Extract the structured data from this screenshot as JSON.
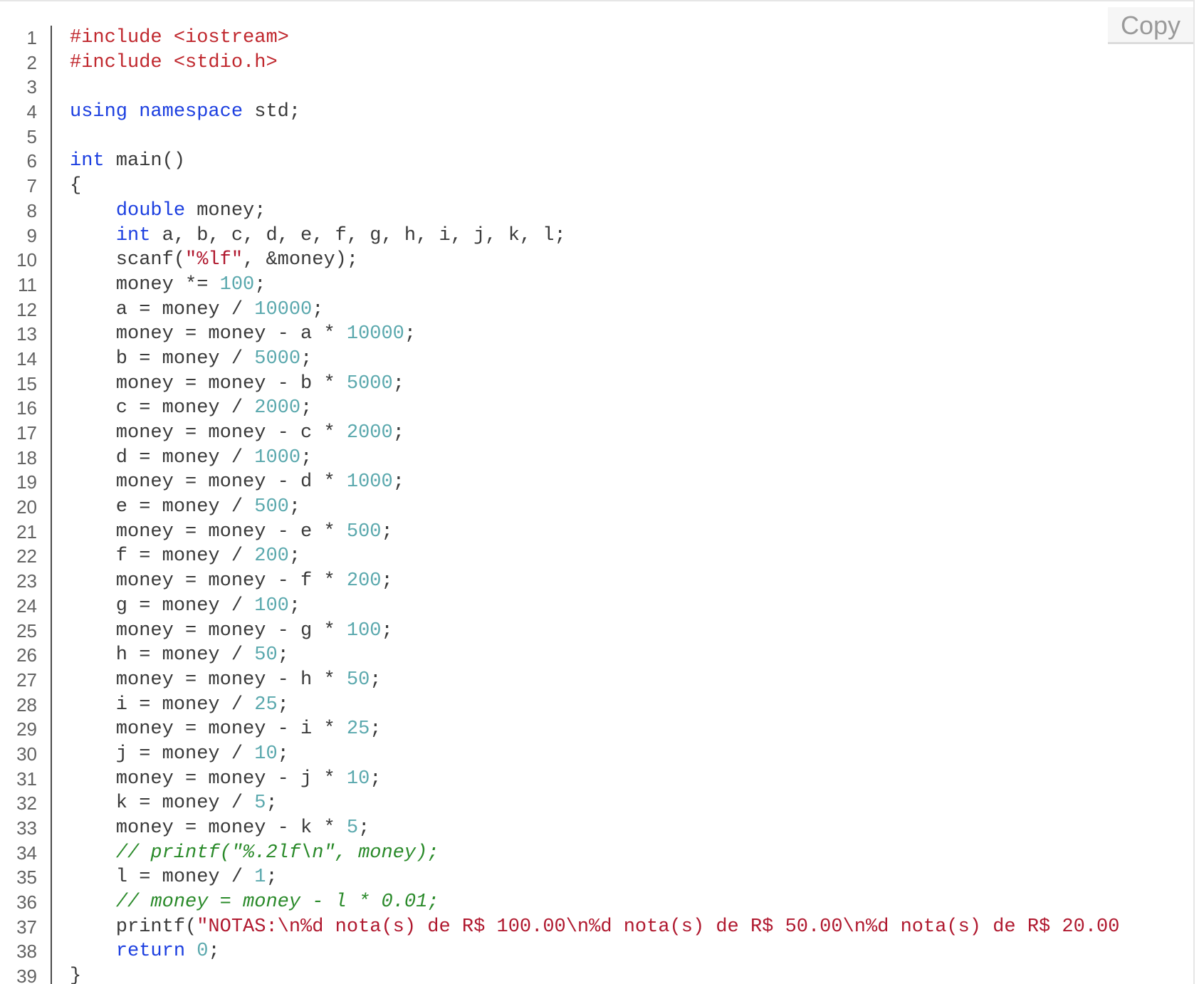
{
  "copy_button": {
    "label": "Copy"
  },
  "colors": {
    "keyword": "#1c3fe0",
    "preprocessor": "#c0282e",
    "string": "#b0192f",
    "number": "#5aa8ad",
    "comment": "#2a8a2a",
    "plain": "#3a3a3a",
    "line_number": "#636363"
  },
  "code": {
    "language": "cpp",
    "lines": [
      {
        "n": "1",
        "tokens": [
          {
            "t": "preproc",
            "v": "#include <iostream>"
          }
        ]
      },
      {
        "n": "2",
        "tokens": [
          {
            "t": "preproc",
            "v": "#include <stdio.h>"
          }
        ]
      },
      {
        "n": "3",
        "tokens": []
      },
      {
        "n": "4",
        "tokens": [
          {
            "t": "keyword",
            "v": "using"
          },
          {
            "t": "plain",
            "v": " "
          },
          {
            "t": "keyword",
            "v": "namespace"
          },
          {
            "t": "plain",
            "v": " std;"
          }
        ]
      },
      {
        "n": "5",
        "tokens": []
      },
      {
        "n": "6",
        "tokens": [
          {
            "t": "keyword",
            "v": "int"
          },
          {
            "t": "plain",
            "v": " main()"
          }
        ]
      },
      {
        "n": "7",
        "tokens": [
          {
            "t": "plain",
            "v": "{"
          }
        ]
      },
      {
        "n": "8",
        "tokens": [
          {
            "t": "plain",
            "v": "    "
          },
          {
            "t": "keyword",
            "v": "double"
          },
          {
            "t": "plain",
            "v": " money;"
          }
        ]
      },
      {
        "n": "9",
        "tokens": [
          {
            "t": "plain",
            "v": "    "
          },
          {
            "t": "keyword",
            "v": "int"
          },
          {
            "t": "plain",
            "v": " a, b, c, d, e, f, g, h, i, j, k, l;"
          }
        ]
      },
      {
        "n": "10",
        "tokens": [
          {
            "t": "plain",
            "v": "    scanf("
          },
          {
            "t": "string",
            "v": "\"%lf\""
          },
          {
            "t": "plain",
            "v": ", &money);"
          }
        ]
      },
      {
        "n": "11",
        "tokens": [
          {
            "t": "plain",
            "v": "    money *= "
          },
          {
            "t": "number",
            "v": "100"
          },
          {
            "t": "plain",
            "v": ";"
          }
        ]
      },
      {
        "n": "12",
        "tokens": [
          {
            "t": "plain",
            "v": "    a = money / "
          },
          {
            "t": "number",
            "v": "10000"
          },
          {
            "t": "plain",
            "v": ";"
          }
        ]
      },
      {
        "n": "13",
        "tokens": [
          {
            "t": "plain",
            "v": "    money = money - a * "
          },
          {
            "t": "number",
            "v": "10000"
          },
          {
            "t": "plain",
            "v": ";"
          }
        ]
      },
      {
        "n": "14",
        "tokens": [
          {
            "t": "plain",
            "v": "    b = money / "
          },
          {
            "t": "number",
            "v": "5000"
          },
          {
            "t": "plain",
            "v": ";"
          }
        ]
      },
      {
        "n": "15",
        "tokens": [
          {
            "t": "plain",
            "v": "    money = money - b * "
          },
          {
            "t": "number",
            "v": "5000"
          },
          {
            "t": "plain",
            "v": ";"
          }
        ]
      },
      {
        "n": "16",
        "tokens": [
          {
            "t": "plain",
            "v": "    c = money / "
          },
          {
            "t": "number",
            "v": "2000"
          },
          {
            "t": "plain",
            "v": ";"
          }
        ]
      },
      {
        "n": "17",
        "tokens": [
          {
            "t": "plain",
            "v": "    money = money - c * "
          },
          {
            "t": "number",
            "v": "2000"
          },
          {
            "t": "plain",
            "v": ";"
          }
        ]
      },
      {
        "n": "18",
        "tokens": [
          {
            "t": "plain",
            "v": "    d = money / "
          },
          {
            "t": "number",
            "v": "1000"
          },
          {
            "t": "plain",
            "v": ";"
          }
        ]
      },
      {
        "n": "19",
        "tokens": [
          {
            "t": "plain",
            "v": "    money = money - d * "
          },
          {
            "t": "number",
            "v": "1000"
          },
          {
            "t": "plain",
            "v": ";"
          }
        ]
      },
      {
        "n": "20",
        "tokens": [
          {
            "t": "plain",
            "v": "    e = money / "
          },
          {
            "t": "number",
            "v": "500"
          },
          {
            "t": "plain",
            "v": ";"
          }
        ]
      },
      {
        "n": "21",
        "tokens": [
          {
            "t": "plain",
            "v": "    money = money - e * "
          },
          {
            "t": "number",
            "v": "500"
          },
          {
            "t": "plain",
            "v": ";"
          }
        ]
      },
      {
        "n": "22",
        "tokens": [
          {
            "t": "plain",
            "v": "    f = money / "
          },
          {
            "t": "number",
            "v": "200"
          },
          {
            "t": "plain",
            "v": ";"
          }
        ]
      },
      {
        "n": "23",
        "tokens": [
          {
            "t": "plain",
            "v": "    money = money - f * "
          },
          {
            "t": "number",
            "v": "200"
          },
          {
            "t": "plain",
            "v": ";"
          }
        ]
      },
      {
        "n": "24",
        "tokens": [
          {
            "t": "plain",
            "v": "    g = money / "
          },
          {
            "t": "number",
            "v": "100"
          },
          {
            "t": "plain",
            "v": ";"
          }
        ]
      },
      {
        "n": "25",
        "tokens": [
          {
            "t": "plain",
            "v": "    money = money - g * "
          },
          {
            "t": "number",
            "v": "100"
          },
          {
            "t": "plain",
            "v": ";"
          }
        ]
      },
      {
        "n": "26",
        "tokens": [
          {
            "t": "plain",
            "v": "    h = money / "
          },
          {
            "t": "number",
            "v": "50"
          },
          {
            "t": "plain",
            "v": ";"
          }
        ]
      },
      {
        "n": "27",
        "tokens": [
          {
            "t": "plain",
            "v": "    money = money - h * "
          },
          {
            "t": "number",
            "v": "50"
          },
          {
            "t": "plain",
            "v": ";"
          }
        ]
      },
      {
        "n": "28",
        "tokens": [
          {
            "t": "plain",
            "v": "    i = money / "
          },
          {
            "t": "number",
            "v": "25"
          },
          {
            "t": "plain",
            "v": ";"
          }
        ]
      },
      {
        "n": "29",
        "tokens": [
          {
            "t": "plain",
            "v": "    money = money - i * "
          },
          {
            "t": "number",
            "v": "25"
          },
          {
            "t": "plain",
            "v": ";"
          }
        ]
      },
      {
        "n": "30",
        "tokens": [
          {
            "t": "plain",
            "v": "    j = money / "
          },
          {
            "t": "number",
            "v": "10"
          },
          {
            "t": "plain",
            "v": ";"
          }
        ]
      },
      {
        "n": "31",
        "tokens": [
          {
            "t": "plain",
            "v": "    money = money - j * "
          },
          {
            "t": "number",
            "v": "10"
          },
          {
            "t": "plain",
            "v": ";"
          }
        ]
      },
      {
        "n": "32",
        "tokens": [
          {
            "t": "plain",
            "v": "    k = money / "
          },
          {
            "t": "number",
            "v": "5"
          },
          {
            "t": "plain",
            "v": ";"
          }
        ]
      },
      {
        "n": "33",
        "tokens": [
          {
            "t": "plain",
            "v": "    money = money - k * "
          },
          {
            "t": "number",
            "v": "5"
          },
          {
            "t": "plain",
            "v": ";"
          }
        ]
      },
      {
        "n": "34",
        "tokens": [
          {
            "t": "plain",
            "v": "    "
          },
          {
            "t": "comment",
            "v": "// printf(\"%.2lf\\n\", money);"
          }
        ]
      },
      {
        "n": "35",
        "tokens": [
          {
            "t": "plain",
            "v": "    l = money / "
          },
          {
            "t": "number",
            "v": "1"
          },
          {
            "t": "plain",
            "v": ";"
          }
        ]
      },
      {
        "n": "36",
        "tokens": [
          {
            "t": "plain",
            "v": "    "
          },
          {
            "t": "comment",
            "v": "// money = money - l * 0.01;"
          }
        ]
      },
      {
        "n": "37",
        "tokens": [
          {
            "t": "plain",
            "v": "    printf("
          },
          {
            "t": "string",
            "v": "\"NOTAS:\\n%d nota(s) de R$ 100.00\\n%d nota(s) de R$ 50.00\\n%d nota(s) de R$ 20.00"
          }
        ]
      },
      {
        "n": "38",
        "tokens": [
          {
            "t": "plain",
            "v": "    "
          },
          {
            "t": "keyword",
            "v": "return"
          },
          {
            "t": "plain",
            "v": " "
          },
          {
            "t": "number",
            "v": "0"
          },
          {
            "t": "plain",
            "v": ";"
          }
        ]
      },
      {
        "n": "39",
        "tokens": [
          {
            "t": "plain",
            "v": "}"
          }
        ]
      }
    ]
  }
}
